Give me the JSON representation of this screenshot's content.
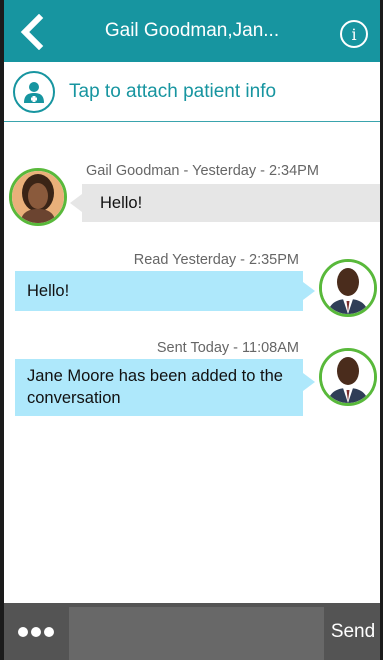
{
  "header": {
    "title": "Gail Goodman,Jan...",
    "back_icon": "chevron-left-icon",
    "info_icon": "info-icon",
    "info_glyph": "i"
  },
  "attach": {
    "icon": "patient-icon",
    "label": "Tap to attach patient info"
  },
  "messages": [
    {
      "direction": "incoming",
      "meta": "Gail Goodman - Yesterday - 2:34PM",
      "text": "Hello!",
      "avatar": "female-avatar"
    },
    {
      "direction": "outgoing",
      "meta": "Read Yesterday - 2:35PM",
      "text": "Hello!",
      "avatar": "male-avatar"
    },
    {
      "direction": "outgoing",
      "meta": "Sent Today - 11:08AM",
      "text": "Jane Moore has been added to the conversation",
      "avatar": "male-avatar"
    }
  ],
  "composer": {
    "more_icon": "more-dots-icon",
    "input_value": "",
    "send_label": "Send"
  },
  "colors": {
    "header": "#1795a0",
    "incoming_bubble": "#e6e6e6",
    "outgoing_bubble": "#aee8fb",
    "avatar_ring": "#59b93b",
    "bottom_bar": "#545454"
  }
}
